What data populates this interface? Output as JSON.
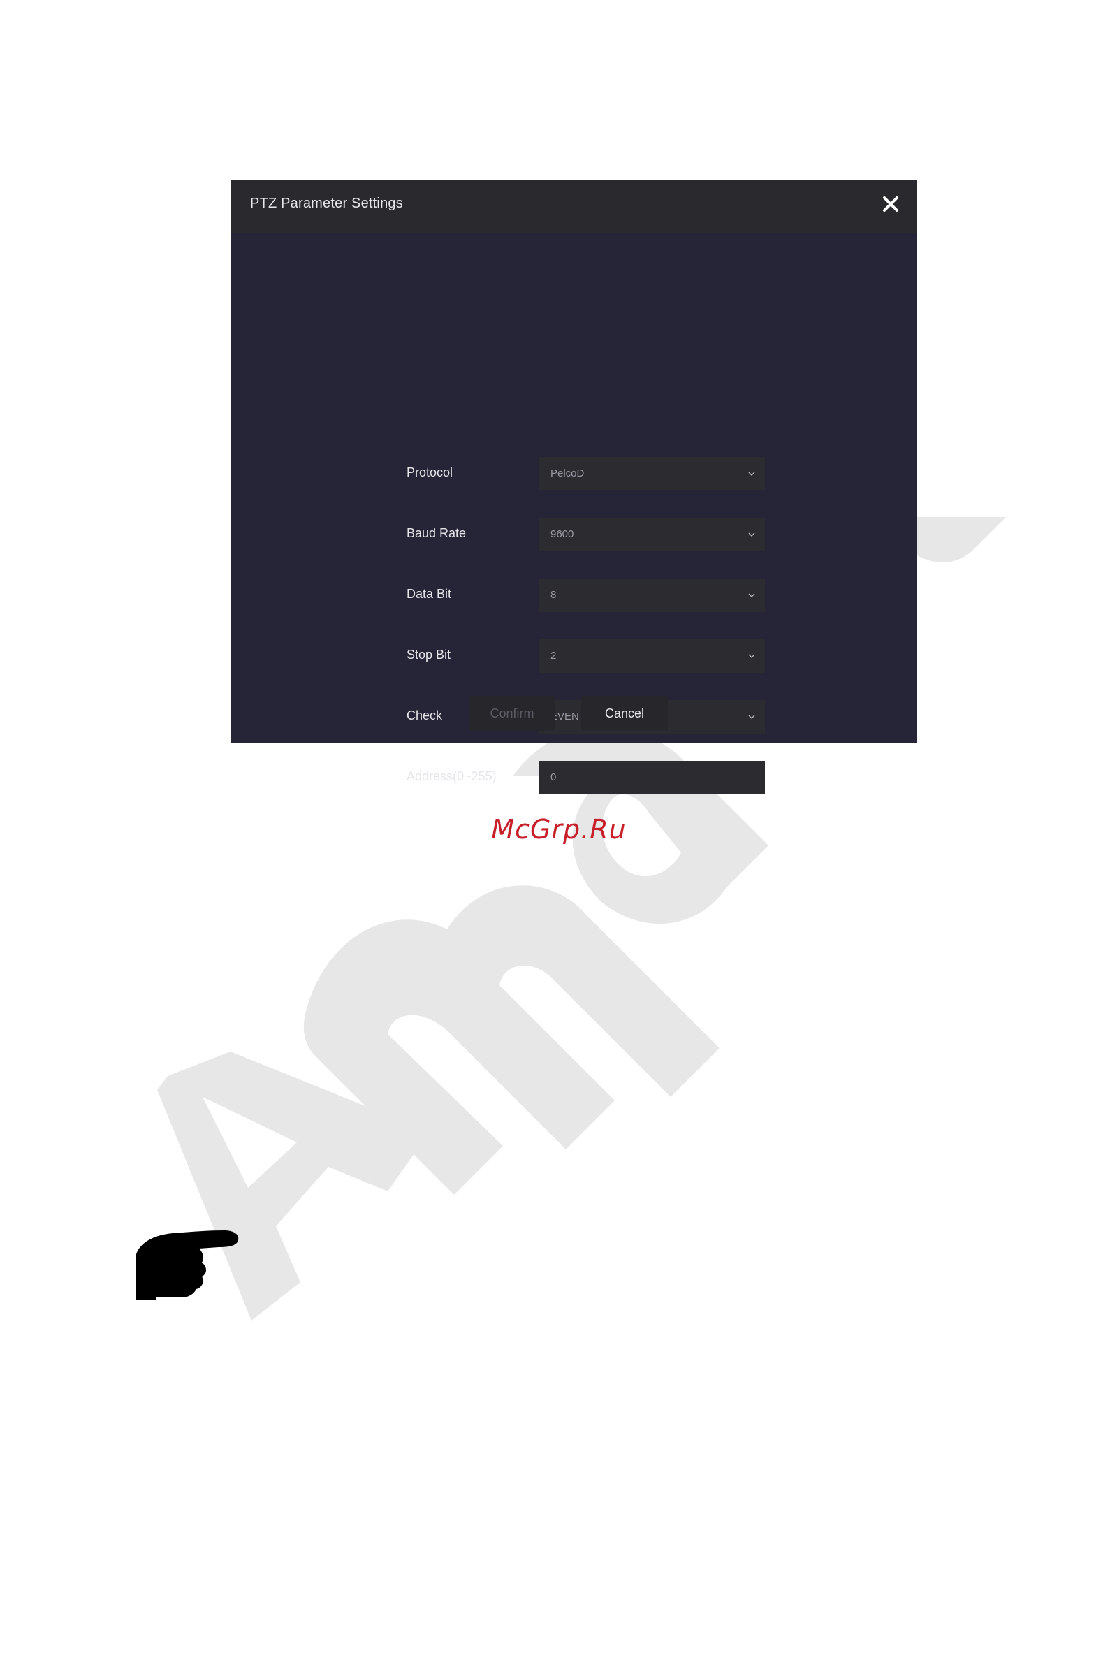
{
  "watermark": {
    "color": "#e7e7e7",
    "icon": "amatek-watermark-logo"
  },
  "dialog": {
    "title": "PTZ Parameter Settings",
    "close_icon": "close-icon",
    "fields": [
      {
        "label": "Protocol",
        "value": "PelcoD",
        "type": "select"
      },
      {
        "label": "Baud Rate",
        "value": "9600",
        "type": "select"
      },
      {
        "label": "Data Bit",
        "value": "8",
        "type": "select"
      },
      {
        "label": "Stop Bit",
        "value": "2",
        "type": "select"
      },
      {
        "label": "Check",
        "value": "EVEN",
        "type": "select"
      },
      {
        "label": "Address(0~255)",
        "value": "0",
        "type": "input"
      }
    ],
    "confirm_label": "Confirm",
    "cancel_label": "Cancel"
  },
  "site_credit": "McGrp.Ru",
  "note_icon": "pointing-hand-icon"
}
